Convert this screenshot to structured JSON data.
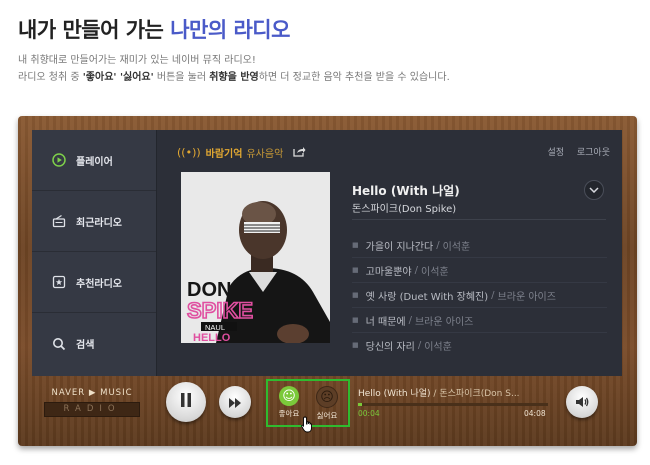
{
  "header": {
    "title_main": "내가 만들어 가는",
    "title_highlight": "나만의 라디오",
    "desc_line1": "내 취향대로 만들어가는 재미가 있는 네이버 뮤직 라디오!",
    "desc_line2_pre": "라디오 청취 중 ",
    "desc_line2_bold1": "'좋아요' '싫어요'",
    "desc_line2_mid": " 버튼을 눌러 ",
    "desc_line2_bold2": "취향을 반영",
    "desc_line2_post": "하면 더 정교한 음악 추천을 받을 수 있습니다."
  },
  "sidebar": {
    "items": [
      {
        "label": "플레이어",
        "icon": "play-circle-icon"
      },
      {
        "label": "최근라디오",
        "icon": "recent-radio-icon"
      },
      {
        "label": "추천라디오",
        "icon": "recommend-radio-icon"
      },
      {
        "label": "검색",
        "icon": "search-icon"
      }
    ]
  },
  "station": {
    "name": "바람기억",
    "similar": "유사음악"
  },
  "top_links": {
    "settings": "설정",
    "logout": "로그아웃"
  },
  "album_art": {
    "line1": "DON",
    "line2": "SPIKE",
    "line3": "NAUL",
    "line4": "HELLO"
  },
  "song": {
    "title": "Hello (With 나얼)",
    "artist": "돈스파이크(Don Spike)"
  },
  "tracks": [
    {
      "title": "가을이 지나간다",
      "artist": "이석훈"
    },
    {
      "title": "고마울뿐야",
      "artist": "이석훈"
    },
    {
      "title": "옛 사랑 (Duet With 장혜진)",
      "artist": "브라운 아이즈"
    },
    {
      "title": "너 때문에",
      "artist": "브라운 아이즈"
    },
    {
      "title": "당신의 자리",
      "artist": "이석훈"
    }
  ],
  "brand": {
    "line1": "NAVER ▶ MUSIC",
    "line2": "RADIO"
  },
  "controls": {
    "like_label": "좋아요",
    "dislike_label": "싫어요"
  },
  "now_playing": {
    "title": "Hello (With 나얼)",
    "divider": " / ",
    "artist": "돈스파이크(Don S...",
    "current_time": "00:04",
    "total_time": "04:08",
    "progress": 0.02
  },
  "colors": {
    "accent_green": "#7bc93a",
    "highlight_box": "#2fbb2f",
    "station_orange": "#e2a832",
    "title_blue": "#4a5ac8"
  }
}
